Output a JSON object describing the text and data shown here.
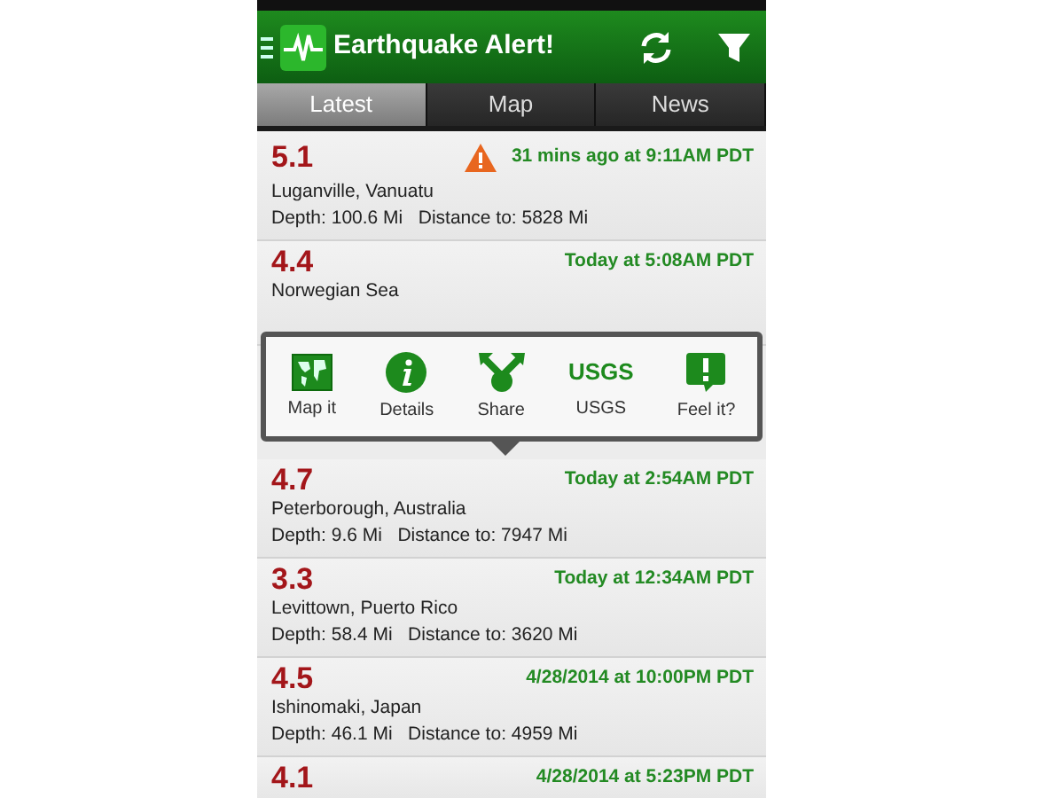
{
  "app_bar": {
    "title": "Earthquake Alert!"
  },
  "tabs": [
    {
      "label": "Latest",
      "selected": true
    },
    {
      "label": "Map",
      "selected": false
    },
    {
      "label": "News",
      "selected": false
    }
  ],
  "quakes": [
    {
      "magnitude": "5.1",
      "time": "31 mins ago at 9:11AM PDT",
      "warning": true,
      "place": "Luganville, Vanuatu",
      "details": "Depth: 100.6 Mi   Distance to: 5828 Mi"
    },
    {
      "magnitude": "4.4",
      "time": "Today at 5:08AM PDT",
      "warning": false,
      "place": "Norwegian Sea",
      "actions_open": true
    },
    {
      "magnitude": "4.7",
      "time": "Today at 2:54AM PDT",
      "warning": false,
      "place": "Peterborough, Australia",
      "details": "Depth: 9.6 Mi   Distance to: 7947 Mi"
    },
    {
      "magnitude": "3.3",
      "time": "Today at 12:34AM PDT",
      "warning": false,
      "place": "Levittown, Puerto Rico",
      "details": "Depth: 58.4 Mi   Distance to: 3620 Mi"
    },
    {
      "magnitude": "4.5",
      "time": "4/28/2014 at 10:00PM PDT",
      "warning": false,
      "place": "Ishinomaki, Japan",
      "details": "Depth: 46.1 Mi   Distance to: 4959 Mi"
    },
    {
      "magnitude": "4.1",
      "time": "4/28/2014 at 5:23PM PDT",
      "warning": false
    }
  ],
  "action_popup": {
    "actions": [
      {
        "kind": "map",
        "label": "Map it"
      },
      {
        "kind": "details",
        "label": "Details"
      },
      {
        "kind": "share",
        "label": "Share"
      },
      {
        "kind": "usgs",
        "label": "USGS",
        "logo": "USGS"
      },
      {
        "kind": "feel",
        "label": "Feel it?"
      }
    ]
  }
}
